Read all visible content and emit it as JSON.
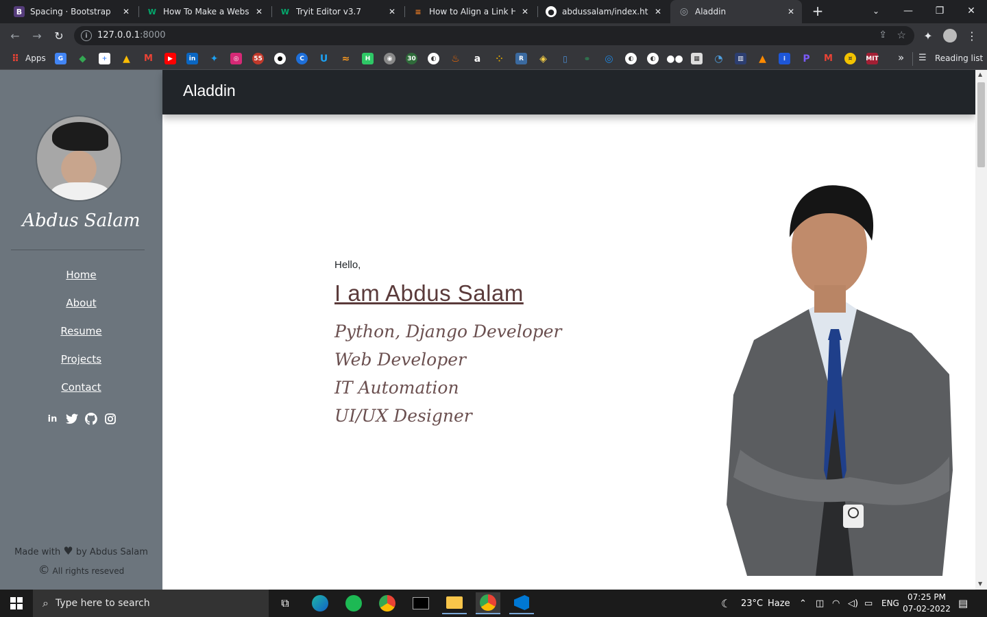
{
  "browser": {
    "tabs": [
      {
        "title": "Spacing · Bootstrap",
        "favicon": "bootstrap-icon",
        "color": "#563d7c",
        "glyph": "B"
      },
      {
        "title": "How To Make a Website",
        "favicon": "w3-icon",
        "color": "#04aa6d",
        "glyph": "W"
      },
      {
        "title": "Tryit Editor v3.7",
        "favicon": "w3-icon",
        "color": "#04aa6d",
        "glyph": "W"
      },
      {
        "title": "How to Align a Link HTML",
        "favicon": "stackoverflow-icon",
        "color": "#f48024",
        "glyph": "S"
      },
      {
        "title": "abdussalam/index.html at",
        "favicon": "github-icon",
        "color": "#ffffff",
        "glyph": "G"
      },
      {
        "title": "Aladdin",
        "favicon": "globe-icon",
        "color": "#9aa0a6",
        "glyph": "◎"
      }
    ],
    "url": {
      "host": "127.0.0.1",
      "port": ":8000"
    },
    "bookmarks": {
      "apps_label": "Apps",
      "reading_list_label": "Reading list",
      "overflow": "»"
    }
  },
  "sidebar": {
    "name": "Abdus Salam",
    "nav": [
      "Home",
      "About",
      "Resume",
      "Projects",
      "Contact"
    ],
    "socials": [
      "linkedin-icon",
      "twitter-icon",
      "github-icon",
      "instagram-icon"
    ],
    "footer_made": "Made with",
    "footer_by": "by Abdus Salam",
    "footer_rights": "All rights reseved"
  },
  "header": {
    "brand": "Aladdin"
  },
  "hero": {
    "greeting": "Hello,",
    "title": "I am Abdus Salam",
    "roles": [
      "Python, Django Developer",
      "Web Developer",
      "IT Automation",
      "UI/UX Designer"
    ]
  },
  "taskbar": {
    "search_placeholder": "Type here to search",
    "weather": "23°C",
    "weather_desc": "Haze",
    "lang": "ENG",
    "time": "07:25 PM",
    "date": "07-02-2022"
  },
  "colors": {
    "sidebar": "#6c757d",
    "header": "#212529",
    "accent_text": "#5a3a3a"
  }
}
